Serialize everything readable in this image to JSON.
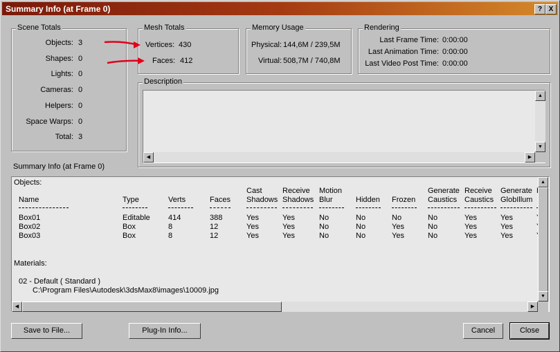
{
  "window": {
    "title": "Summary Info (at Frame 0)",
    "help_btn": "?",
    "close_btn": "X"
  },
  "scene_totals": {
    "legend": "Scene Totals",
    "rows": [
      {
        "label": "Objects:",
        "value": "3"
      },
      {
        "label": "Shapes:",
        "value": "0"
      },
      {
        "label": "Lights:",
        "value": "0"
      },
      {
        "label": "Cameras:",
        "value": "0"
      },
      {
        "label": "Helpers:",
        "value": "0"
      },
      {
        "label": "Space Warps:",
        "value": "0"
      },
      {
        "label": "Total:",
        "value": "3"
      }
    ]
  },
  "mesh_totals": {
    "legend": "Mesh Totals",
    "vertices_label": "Vertices:",
    "vertices_value": "430",
    "faces_label": "Faces:",
    "faces_value": "412"
  },
  "memory_usage": {
    "legend": "Memory Usage",
    "physical_label": "Physical:",
    "physical_value": "144,6M / 239,5M",
    "virtual_label": "Virtual:",
    "virtual_value": "508,7M / 740,8M"
  },
  "rendering": {
    "legend": "Rendering",
    "rows": [
      {
        "label": "Last Frame Time:",
        "value": "0:00:00"
      },
      {
        "label": "Last Animation Time:",
        "value": "0:00:00"
      },
      {
        "label": "Last Video Post Time:",
        "value": "0:00:00"
      }
    ]
  },
  "description": {
    "legend": "Description",
    "text": ""
  },
  "summary": {
    "title": "Summary Info (at Frame 0)",
    "objects_header": "Objects:",
    "columns": [
      {
        "line1": "",
        "line2": "Name"
      },
      {
        "line1": "",
        "line2": "Type"
      },
      {
        "line1": "",
        "line2": "Verts"
      },
      {
        "line1": "",
        "line2": "Faces"
      },
      {
        "line1": "Cast",
        "line2": "Shadows"
      },
      {
        "line1": "Receive",
        "line2": "Shadows"
      },
      {
        "line1": "Motion",
        "line2": "Blur"
      },
      {
        "line1": "",
        "line2": "Hidden"
      },
      {
        "line1": "",
        "line2": "Frozen"
      },
      {
        "line1": "Generate",
        "line2": "Caustics"
      },
      {
        "line1": "Receive",
        "line2": "Caustics"
      },
      {
        "line1": "Generate",
        "line2": "GlobIllum"
      },
      {
        "line1": "F",
        "line2": ""
      }
    ],
    "rows": [
      [
        "Box01",
        "Editable",
        "414",
        "388",
        "Yes",
        "Yes",
        "No",
        "No",
        "No",
        "No",
        "Yes",
        "Yes",
        "Y"
      ],
      [
        "Box02",
        "Box",
        "8",
        "12",
        "Yes",
        "Yes",
        "No",
        "No",
        "Yes",
        "No",
        "Yes",
        "Yes",
        "Y"
      ],
      [
        "Box03",
        "Box",
        "8",
        "12",
        "Yes",
        "Yes",
        "No",
        "No",
        "Yes",
        "No",
        "Yes",
        "Yes",
        "Y"
      ]
    ],
    "materials_header": "Materials:",
    "material_name": "02 - Default  ( Standard )",
    "material_path": "C:\\Program Files\\Autodesk\\3dsMax8\\images\\10009.jpg"
  },
  "buttons": {
    "save": "Save to File...",
    "plugin": "Plug-In Info...",
    "cancel": "Cancel",
    "close": "Close"
  },
  "colors": {
    "annotation_arrow": "#e0001a",
    "title_start": "#7a1a0a",
    "title_end": "#d68a2a"
  }
}
